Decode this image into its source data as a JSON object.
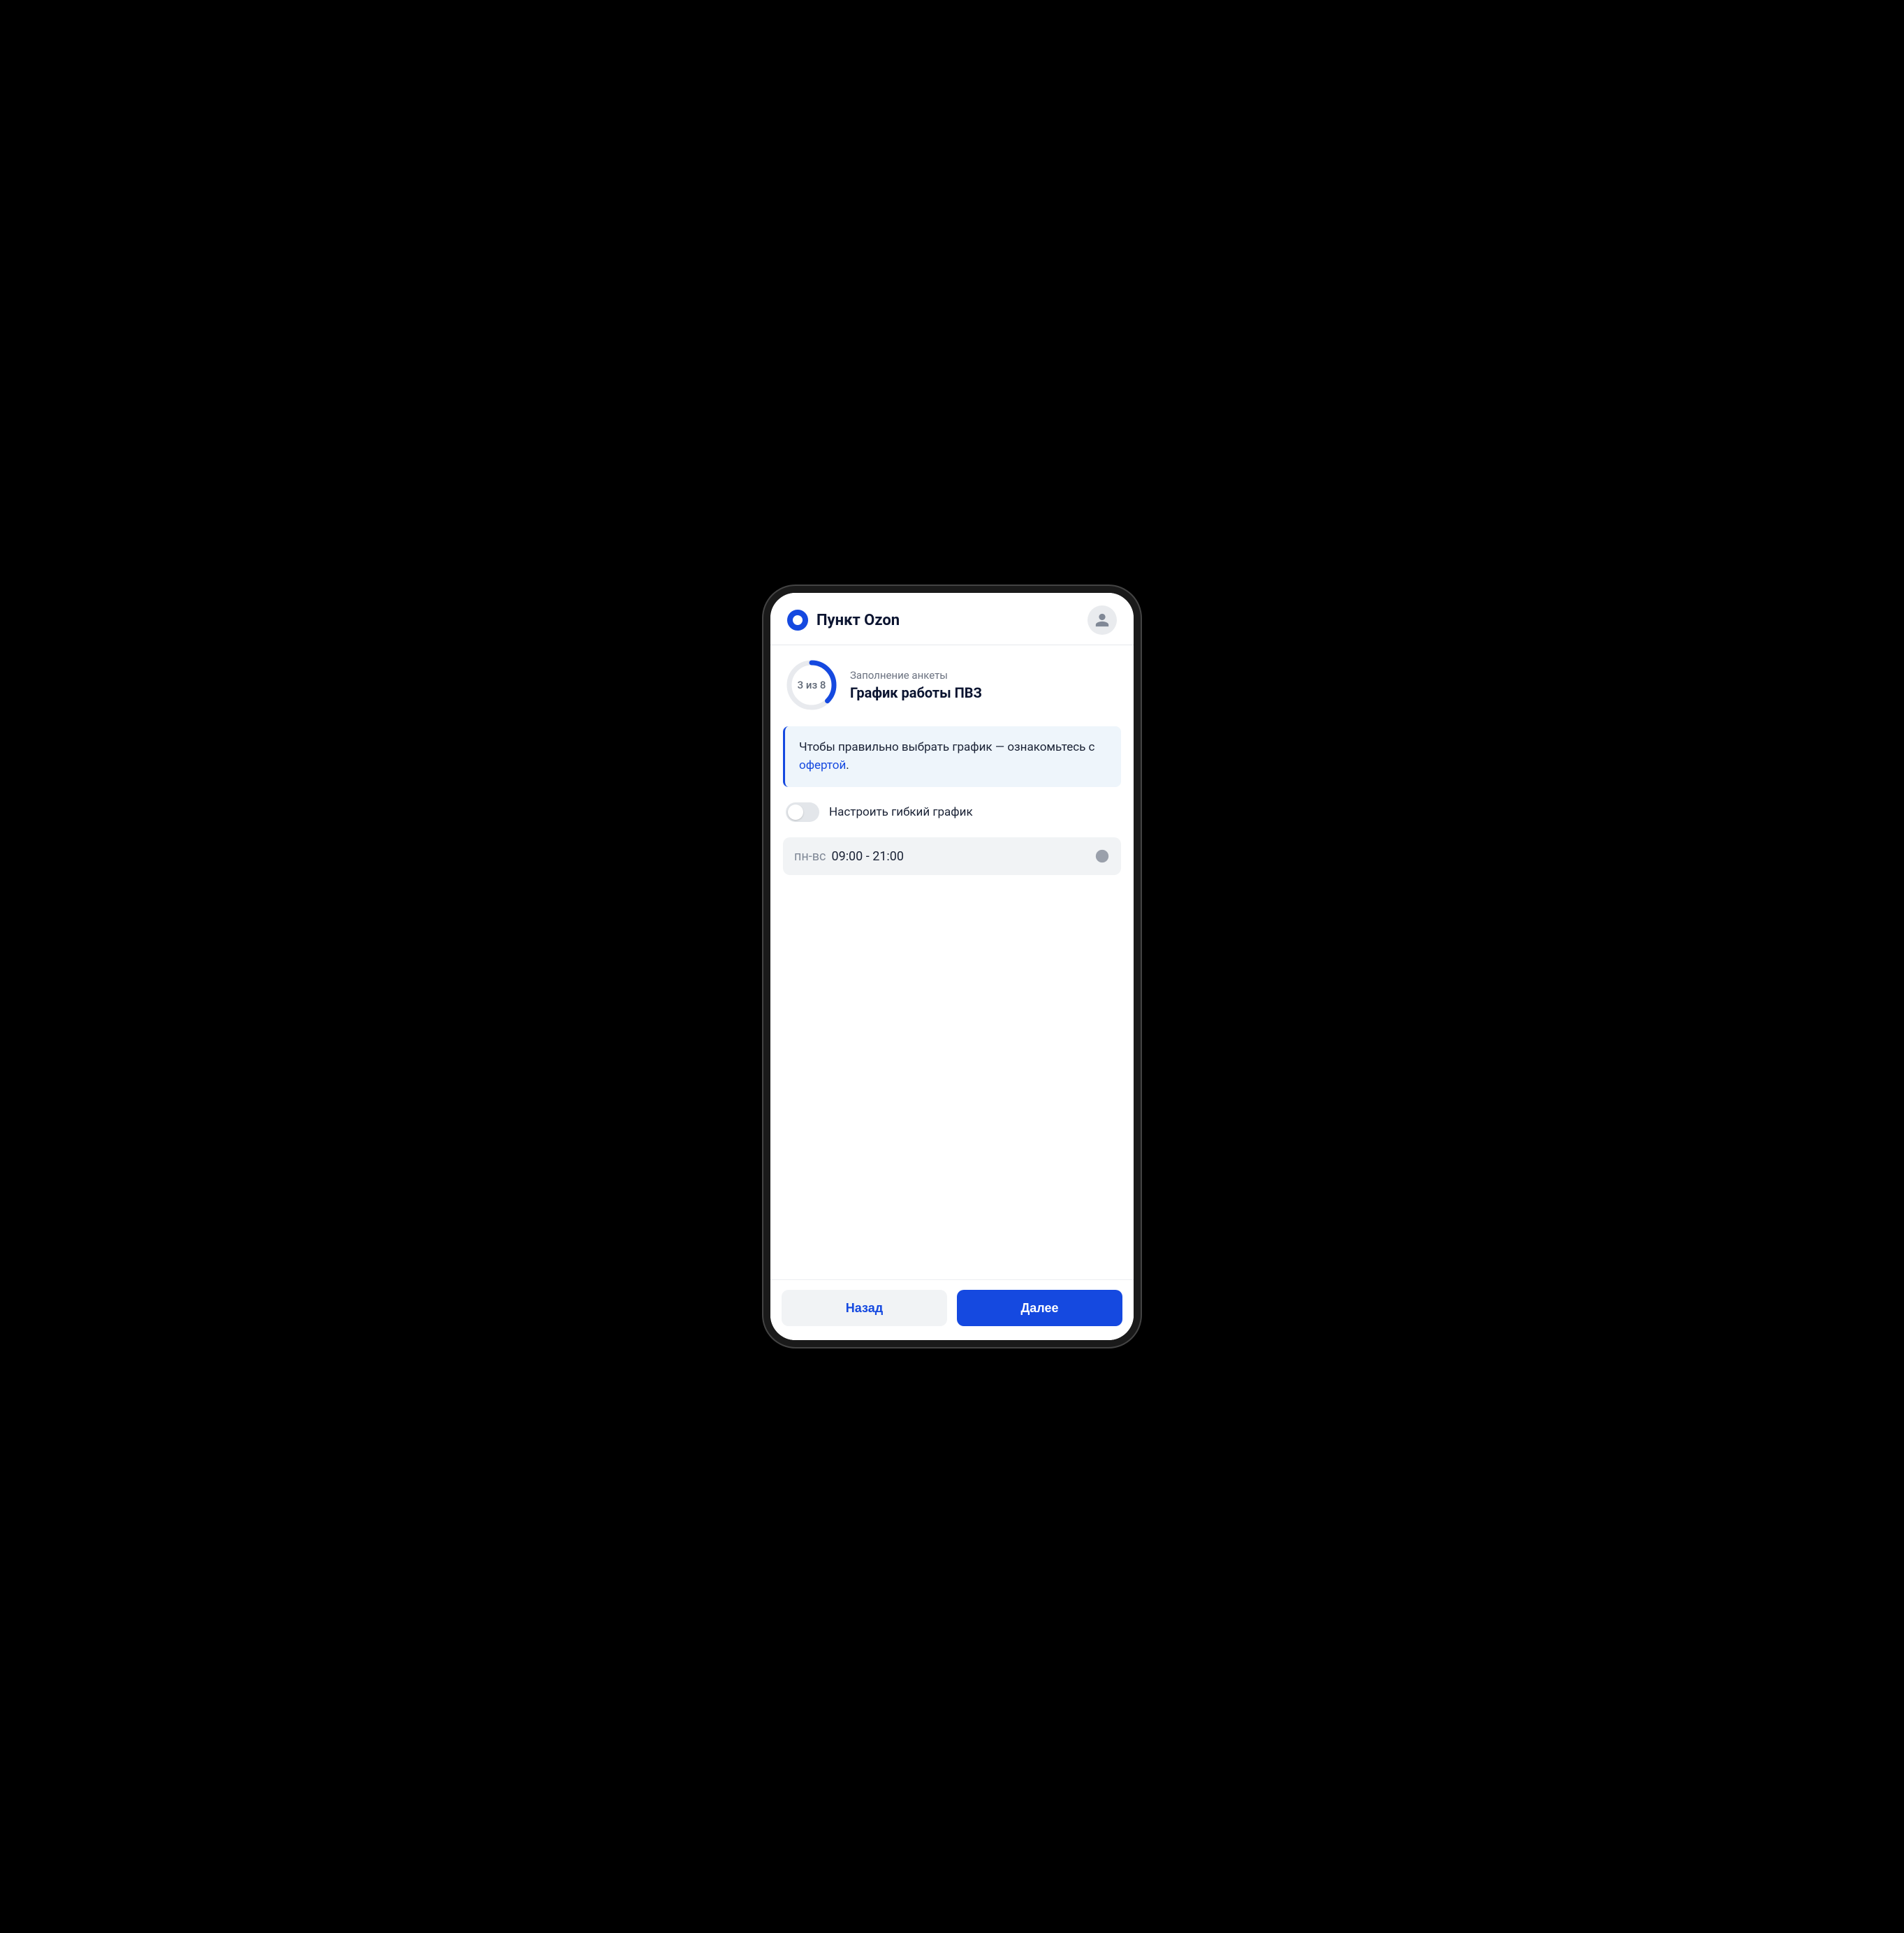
{
  "header": {
    "title": "Пункт Ozon"
  },
  "progress": {
    "step": 3,
    "total": 8,
    "step_label": "3 из 8",
    "overline": "Заполнение анкеты",
    "title": "График работы ПВЗ"
  },
  "banner": {
    "prefix": "Чтобы правильно выбрать график — ознакомьтесь с ",
    "link": "офертой",
    "suffix": "."
  },
  "toggle": {
    "label": "Настроить гибкий график",
    "on": false
  },
  "schedule": {
    "days": "пн-вс",
    "hours": "09:00 - 21:00"
  },
  "footer": {
    "back": "Назад",
    "next": "Далее"
  },
  "colors": {
    "accent": "#1549e0"
  }
}
